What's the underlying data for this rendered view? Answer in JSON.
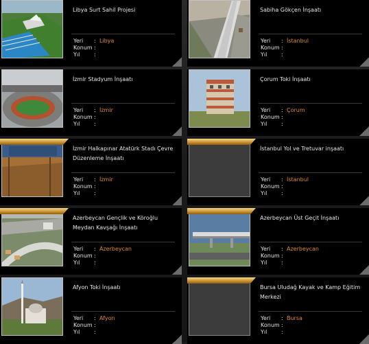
{
  "labels": {
    "location": "Yeri",
    "position": "Konum",
    "year": "Yıl",
    "sep": ":"
  },
  "accent": "#e08a2c",
  "projects": [
    {
      "title": "Libya Surt Sahil Projesi",
      "location": "Libya",
      "position": "",
      "year": "",
      "image": "stadium-aerial-image"
    },
    {
      "title": "Sabiha Gökçen İnşaatı",
      "location": "İstanbul",
      "position": "",
      "year": "",
      "image": "airport-road-image"
    },
    {
      "title": "İzmir Stadyum İnşaatı",
      "location": "İzmir",
      "position": "",
      "year": "",
      "image": "stadium-interior-image"
    },
    {
      "title": "Çorum Toki İnşaatı",
      "location": "Çorum",
      "position": "",
      "year": "",
      "image": "apartment-building-image"
    },
    {
      "title": "İzmir Halkapınar Atatürk Stadı Çevre Düzenleme İnşaatı",
      "location": "İzmir",
      "position": "",
      "year": "",
      "image": "arena-construction-image"
    },
    {
      "title": "İstanbul Yol ve Tretuvar inşaatı",
      "location": "İstanbul",
      "position": "",
      "year": "",
      "image": ""
    },
    {
      "title": "Azerbeycan Gençlik ve Köroğlu Meydan Kavşağı İnşaatı",
      "location": "Azerbeycan",
      "position": "",
      "year": "",
      "image": "interchange-render-image"
    },
    {
      "title": "Azerbeycan Üst Geçit İnşaatı",
      "location": "Azerbeycan",
      "position": "",
      "year": "",
      "image": "overpass-image"
    },
    {
      "title": "Afyon Toki İnşaatı",
      "location": "Afyon",
      "position": "",
      "year": "",
      "image": "mosque-image"
    },
    {
      "title": "Bursa Uludağ Kayak ve Kamp Eğitim Merkezi",
      "location": "Bursa",
      "position": "",
      "year": "",
      "image": ""
    }
  ]
}
